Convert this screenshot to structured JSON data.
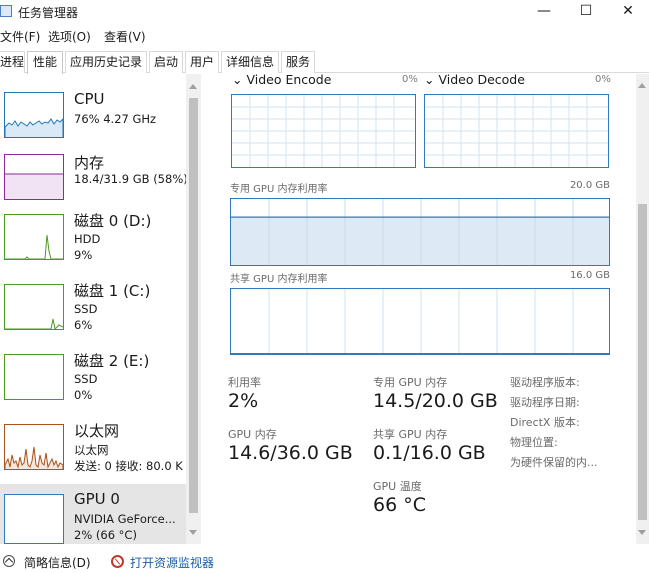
{
  "window": {
    "title": "任务管理器",
    "min_glyph": "—",
    "max_glyph": "☐",
    "close_glyph": "✕"
  },
  "menu": {
    "file": "文件(F)",
    "options": "选项(O)",
    "view": "查看(V)"
  },
  "tabs": [
    {
      "label": "进程"
    },
    {
      "label": "性能"
    },
    {
      "label": "应用历史记录"
    },
    {
      "label": "启动"
    },
    {
      "label": "用户"
    },
    {
      "label": "详细信息"
    },
    {
      "label": "服务"
    }
  ],
  "active_tab": "性能",
  "sidebar": {
    "items": [
      {
        "name": "CPU",
        "line1": "76% 4.27 GHz",
        "line2": "",
        "line3": ""
      },
      {
        "name": "内存",
        "line1": "18.4/31.9 GB (58%)",
        "line2": "",
        "line3": ""
      },
      {
        "name": "磁盘 0 (D:)",
        "line1": "HDD",
        "line2": "9%",
        "line3": ""
      },
      {
        "name": "磁盘 1 (C:)",
        "line1": "SSD",
        "line2": "6%",
        "line3": ""
      },
      {
        "name": "磁盘 2 (E:)",
        "line1": "SSD",
        "line2": "0%",
        "line3": ""
      },
      {
        "name": "以太网",
        "line1": "以太网",
        "line2": "发送: 0 接收: 80.0 K",
        "line3": ""
      },
      {
        "name": "GPU 0",
        "line1": "NVIDIA GeForce...",
        "line2": "2% (66 °C)",
        "line3": ""
      }
    ],
    "selected": "GPU 0"
  },
  "main": {
    "video_encode": {
      "label": "Video Encode",
      "pct": "0%"
    },
    "video_decode": {
      "label": "Video Decode",
      "pct": "0%"
    },
    "dedicated_mem": {
      "label": "专用 GPU 内存利用率",
      "max": "20.0 GB",
      "fill_fraction": 0.725
    },
    "shared_mem": {
      "label": "共享 GPU 内存利用率",
      "max": "16.0 GB",
      "fill_fraction": 0.006
    },
    "stats": {
      "utilization_label": "利用率",
      "utilization_value": "2%",
      "dedicated_label": "专用 GPU 内存",
      "dedicated_value": "14.5/20.0 GB",
      "gpu_mem_label": "GPU 内存",
      "gpu_mem_value": "14.6/36.0 GB",
      "shared_label": "共享 GPU 内存",
      "shared_value": "0.1/16.0 GB",
      "temp_label": "GPU 温度",
      "temp_value": "66 °C"
    },
    "info": {
      "driver_version": "驱动程序版本:",
      "driver_date": "驱动程序日期:",
      "directx": "DirectX 版本:",
      "location": "物理位置:",
      "reserved": "为硬件保留的内..."
    }
  },
  "footer": {
    "fewer_details": "简略信息(D)",
    "open_monitor": "打开资源监视器"
  },
  "colors": {
    "cpu": "#1f77b4",
    "memory": "#8b2a9b",
    "disk": "#4d9a22",
    "ethernet": "#a9521b",
    "gpu": "#2f7abf",
    "link": "#1a5ea8"
  }
}
